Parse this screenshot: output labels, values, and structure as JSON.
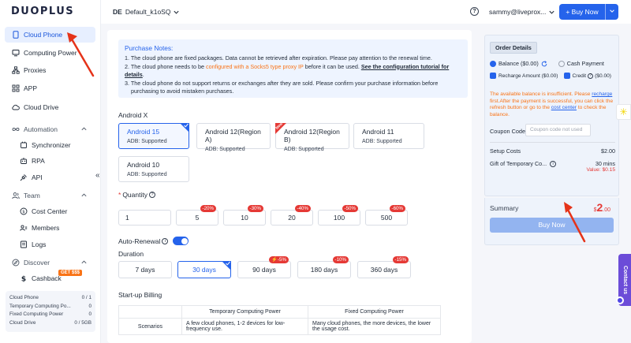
{
  "brand": "DUOPLUS",
  "header": {
    "env_chip": "DE",
    "env_name": "Default_k1oSQ",
    "help": "?",
    "user": "sammy@liveprox...",
    "buy_now": "+ Buy Now"
  },
  "sidebar": {
    "items": [
      {
        "label": "Cloud Phone",
        "icon": "phone-icon"
      },
      {
        "label": "Computing Power",
        "icon": "monitor-icon"
      },
      {
        "label": "Proxies",
        "icon": "network-icon"
      },
      {
        "label": "APP",
        "icon": "grid-icon"
      },
      {
        "label": "Cloud Drive",
        "icon": "cloud-icon"
      },
      {
        "label": "Automation",
        "icon": "infinity-icon"
      },
      {
        "label": "Synchronizer",
        "icon": "sync-icon"
      },
      {
        "label": "RPA",
        "icon": "robot-icon"
      },
      {
        "label": "API",
        "icon": "plug-icon"
      },
      {
        "label": "Team",
        "icon": "users-icon"
      },
      {
        "label": "Cost Center",
        "icon": "coin-icon"
      },
      {
        "label": "Members",
        "icon": "members-icon"
      },
      {
        "label": "Logs",
        "icon": "doc-icon"
      },
      {
        "label": "Discover",
        "icon": "compass-icon"
      },
      {
        "label": "Cashback",
        "icon": "dollar-icon"
      }
    ],
    "cashback_badge": "GET $$$",
    "collapse": "«",
    "stats": [
      {
        "label": "Cloud Phone",
        "value": "0 / 1"
      },
      {
        "label": "Temporary Computing Po...",
        "value": "0"
      },
      {
        "label": "Fixed Computing Power",
        "value": "0"
      },
      {
        "label": "Cloud Drive",
        "value": "0 / 5GB"
      }
    ]
  },
  "notes": {
    "title": "Purchase Notes:",
    "line1": "1. The cloud phone are fixed packages. Data cannot be retrieved after expiration. Please pay attention to the renewal time.",
    "line2_a": "2. The cloud phone needs to be ",
    "line2_b": "configured with a Socks5 type proxy IP",
    "line2_c": " before it can be used. ",
    "line2_link": "See the configuration tutorial for details",
    "line2_d": ".",
    "line3": "3. The cloud phone do not support returns or exchanges after they are sold. Please confirm your purchase information before",
    "line3b": "purchasing to avoid mistaken purchases."
  },
  "android": {
    "title": "Android X",
    "options": [
      {
        "name": "Android 15",
        "adb": "ADB: Supported"
      },
      {
        "name": "Android 12(Region A)",
        "adb": "ADB: Supported"
      },
      {
        "name": "Android 12(Region B)",
        "adb": "ADB: Supported"
      },
      {
        "name": "Android 11",
        "adb": "ADB: Supported"
      },
      {
        "name": "Android 10",
        "adb": "ADB: Supported"
      }
    ],
    "new_tag": "New"
  },
  "quantity": {
    "label": "Quantity",
    "required": "*",
    "value": "1",
    "options": [
      {
        "value": "5",
        "discount": "-20%"
      },
      {
        "value": "10",
        "discount": "-30%"
      },
      {
        "value": "20",
        "discount": "-40%"
      },
      {
        "value": "100",
        "discount": "-50%"
      },
      {
        "value": "500",
        "discount": "-60%"
      }
    ]
  },
  "auto_renewal": {
    "label": "Auto-Renewal",
    "on": true
  },
  "duration": {
    "title": "Duration",
    "options": [
      {
        "label": "7 days",
        "discount": ""
      },
      {
        "label": "30 days",
        "discount": ""
      },
      {
        "label": "90 days",
        "discount": "⚡-5%"
      },
      {
        "label": "180 days",
        "discount": "-10%"
      },
      {
        "label": "360 days",
        "discount": "-15%"
      }
    ]
  },
  "billing": {
    "title": "Start-up Billing",
    "col1": "Temporary Computing Power",
    "col2": "Fixed Computing Power",
    "row_label": "Scenarios",
    "row_col1": "A few cloud phones, 1-2 devices for low-frequency use.",
    "row_col2": "Many cloud phones, the more devices, the lower the usage cost."
  },
  "order": {
    "title": "Order Details",
    "balance": "Balance ($0.00)",
    "cash_payment": "Cash Payment",
    "recharge_amount": "Recharge Amount ($0.00)",
    "credit": "Credit",
    "credit_amount": "($0.00)",
    "warn_a": "The available balance is insufficient. Please ",
    "warn_recharge": "recharge",
    "warn_b": " first.After the payment is successful, you can click the refresh button or go to the ",
    "warn_cost": "cost center",
    "warn_c": " to check the balance.",
    "coupon_label": "Coupon Code",
    "coupon_placeholder": "Coupon code not used",
    "setup_costs_label": "Setup Costs",
    "setup_costs_value": "$2.00",
    "gift_label": "Gift of Temporary Co...",
    "gift_value": "30 mins",
    "gift_value2": "Value: $0.15",
    "summary_label": "Summary",
    "summary_currency": "$",
    "summary_int": "2",
    "summary_dec": ".00",
    "buy_button": "Buy Now"
  },
  "contact": "Contact us",
  "colors": {
    "accent": "#2563eb",
    "discount": "#e53935",
    "warning": "#f97316",
    "arrow": "#e53319"
  }
}
